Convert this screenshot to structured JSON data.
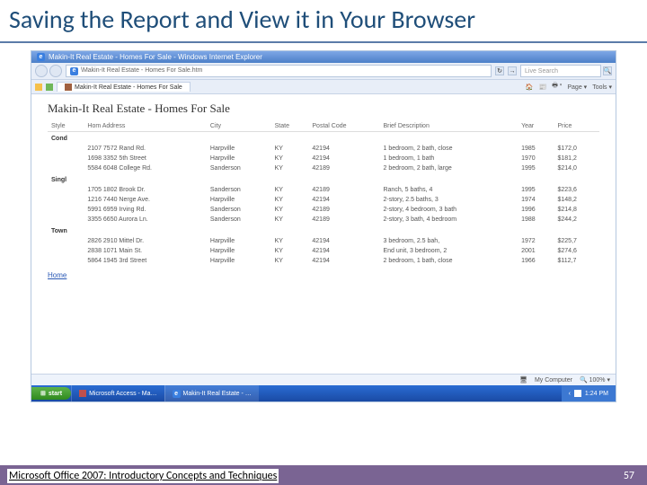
{
  "slide": {
    "title": "Saving the Report and View it in Your Browser",
    "footer": "Microsoft Office 2007: Introductory Concepts and Techniques",
    "page_number": "57"
  },
  "browser": {
    "window_title": "Makin-It Real Estate - Homes For Sale - Windows Internet Explorer",
    "url_text": "\\Makin-It Real Estate - Homes For Sale.htm",
    "refresh_glyph": "↻",
    "go_glyph": "→",
    "search_glyph": "🔍",
    "search_placeholder": "Live Search",
    "tab_label": "Makin-It Real Estate - Homes For Sale",
    "toolbar": {
      "home": "🏠",
      "feed": "📰",
      "print": "🖶 ▾",
      "page": "Page ▾",
      "tools": "Tools ▾"
    },
    "page_heading": "Makin-It Real Estate - Homes For Sale",
    "columns": [
      "Style",
      "Hom Address",
      "City",
      "State",
      "Postal Code",
      "Brief Description",
      "Year",
      "Price"
    ],
    "groups": [
      {
        "label": "Cond",
        "rows": [
          [
            "2107 7572 Rand Rd.",
            "Harpville",
            "KY",
            "42194",
            "1 bedroom, 2 bath, close",
            "1985",
            "$172,0"
          ],
          [
            "1698 3352 5th Street",
            "Harpville",
            "KY",
            "42194",
            "1 bedroom, 1 bath",
            "1970",
            "$181,2"
          ],
          [
            "5584 6048 College Rd.",
            "Sanderson",
            "KY",
            "42189",
            "2 bedroom, 2 bath, large",
            "1995",
            "$214,0"
          ]
        ]
      },
      {
        "label": "Singl",
        "rows": [
          [
            "1705 1802 Brook Dr.",
            "Sanderson",
            "KY",
            "42189",
            "Ranch, 5 baths, 4",
            "1995",
            "$223,6"
          ],
          [
            "1216 7440 Nerge Ave.",
            "Harpville",
            "KY",
            "42194",
            "2-story, 2.5 baths, 3",
            "1974",
            "$148,2"
          ],
          [
            "5991 6959 Irving Rd.",
            "Sanderson",
            "KY",
            "42189",
            "2-story, 4 bedroom, 3 bath",
            "1996",
            "$214,8"
          ],
          [
            "3355 6650 Aurora Ln.",
            "Sanderson",
            "KY",
            "42189",
            "2-story, 3 bath, 4 bedroom",
            "1988",
            "$244,2"
          ]
        ]
      },
      {
        "label": "Town",
        "rows": [
          [
            "2826 2910 Mittel Dr.",
            "Harpville",
            "KY",
            "42194",
            "3 bedroom, 2.5 bah,",
            "1972",
            "$225,7"
          ],
          [
            "2838 1071 Main St.",
            "Harpville",
            "KY",
            "42194",
            "End unit, 3 bedroom, 2",
            "2001",
            "$274,6"
          ],
          [
            "5864 1945 3rd Street",
            "Harpville",
            "KY",
            "42194",
            "2 bedroom, 1 bath, close",
            "1966",
            "$112,7"
          ]
        ]
      }
    ],
    "home_link": "Home",
    "status": {
      "my_computer": "My Computer",
      "pc_glyph": "🖥",
      "zoom": "🔍 100% ▾"
    }
  },
  "taskbar": {
    "start": "start",
    "start_icon": "⊞",
    "items": [
      "Microsoft Access - Ma…",
      "Makin-It Real Estate - …"
    ],
    "time": "1:24 PM",
    "tray_glyph": "‹"
  }
}
